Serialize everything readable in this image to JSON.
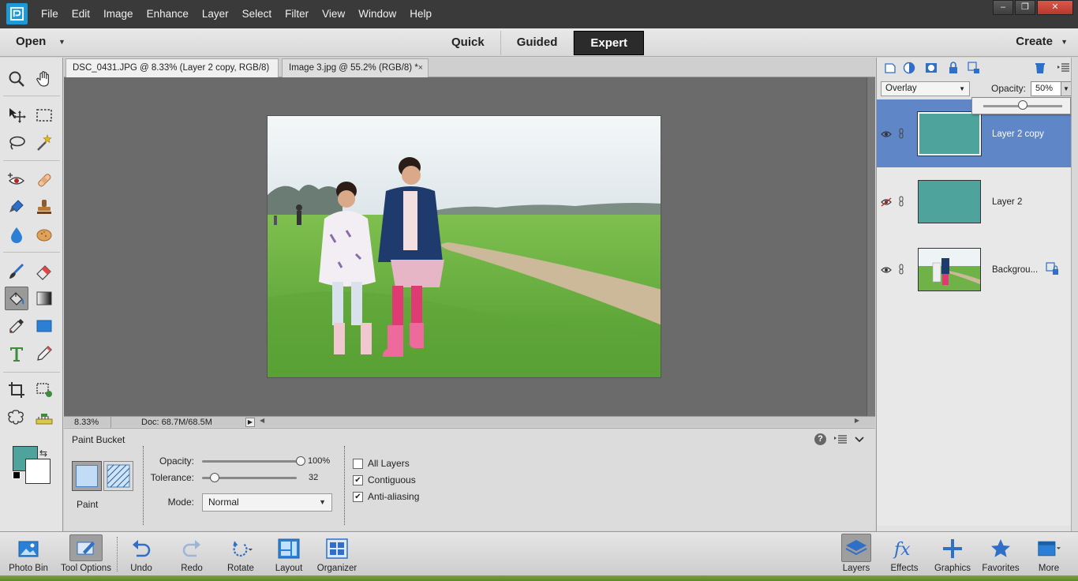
{
  "menu": [
    "File",
    "Edit",
    "Image",
    "Enhance",
    "Layer",
    "Select",
    "Filter",
    "View",
    "Window",
    "Help"
  ],
  "window_controls": {
    "minimize": "–",
    "restore": "❐",
    "close": "✕"
  },
  "modebar": {
    "open_label": "Open",
    "modes": [
      "Quick",
      "Guided",
      "Expert"
    ],
    "active_mode": "Expert",
    "create_label": "Create"
  },
  "doc_tabs": [
    {
      "label": "DSC_0431.JPG @ 8.33% (Layer 2 copy, RGB/8) *",
      "close": "×"
    },
    {
      "label": "Image 3.jpg @ 55.2% (RGB/8) *",
      "close": "×"
    }
  ],
  "status": {
    "zoom": "8.33%",
    "doc_size": "Doc: 68.7M/68.5M"
  },
  "tool_options": {
    "title": "Paint Bucket",
    "help": "?",
    "paint_label": "Paint",
    "opacity_label": "Opacity:",
    "opacity_value": "100%",
    "opacity_level": 1.0,
    "tolerance_label": "Tolerance:",
    "tolerance_value": "32",
    "tolerance_level": 0.13,
    "mode_label": "Mode:",
    "mode_value": "Normal",
    "checkboxes": [
      {
        "label": "All Layers",
        "checked": false
      },
      {
        "label": "Contiguous",
        "checked": true
      },
      {
        "label": "Anti-aliasing",
        "checked": true
      }
    ]
  },
  "colors": {
    "foreground": "#4ea39d",
    "background": "#ffffff",
    "accent_selected_layer": "#5f86c6"
  },
  "layers_panel": {
    "blend_mode": "Overlay",
    "opacity_label": "Opacity:",
    "opacity_value": "50%",
    "opacity_level": 0.5,
    "layers": [
      {
        "name": "Layer 2 copy",
        "visible": true,
        "selected": true
      },
      {
        "name": "Layer 2",
        "visible": false,
        "selected": false
      },
      {
        "name": "Backgrou...",
        "visible": true,
        "selected": false
      }
    ]
  },
  "bottom_bar": [
    {
      "label": "Photo Bin",
      "icon": "photo-bin-icon"
    },
    {
      "label": "Tool Options",
      "icon": "tool-options-icon"
    },
    {
      "label": "Undo",
      "icon": "undo-icon"
    },
    {
      "label": "Redo",
      "icon": "redo-icon"
    },
    {
      "label": "Rotate",
      "icon": "rotate-icon"
    },
    {
      "label": "Layout",
      "icon": "layout-icon"
    },
    {
      "label": "Organizer",
      "icon": "organizer-icon"
    },
    {
      "label": "Layers",
      "icon": "layers-icon"
    },
    {
      "label": "Effects",
      "icon": "effects-icon"
    },
    {
      "label": "Graphics",
      "icon": "graphics-icon"
    },
    {
      "label": "Favorites",
      "icon": "favorites-icon"
    },
    {
      "label": "More",
      "icon": "more-icon"
    }
  ]
}
